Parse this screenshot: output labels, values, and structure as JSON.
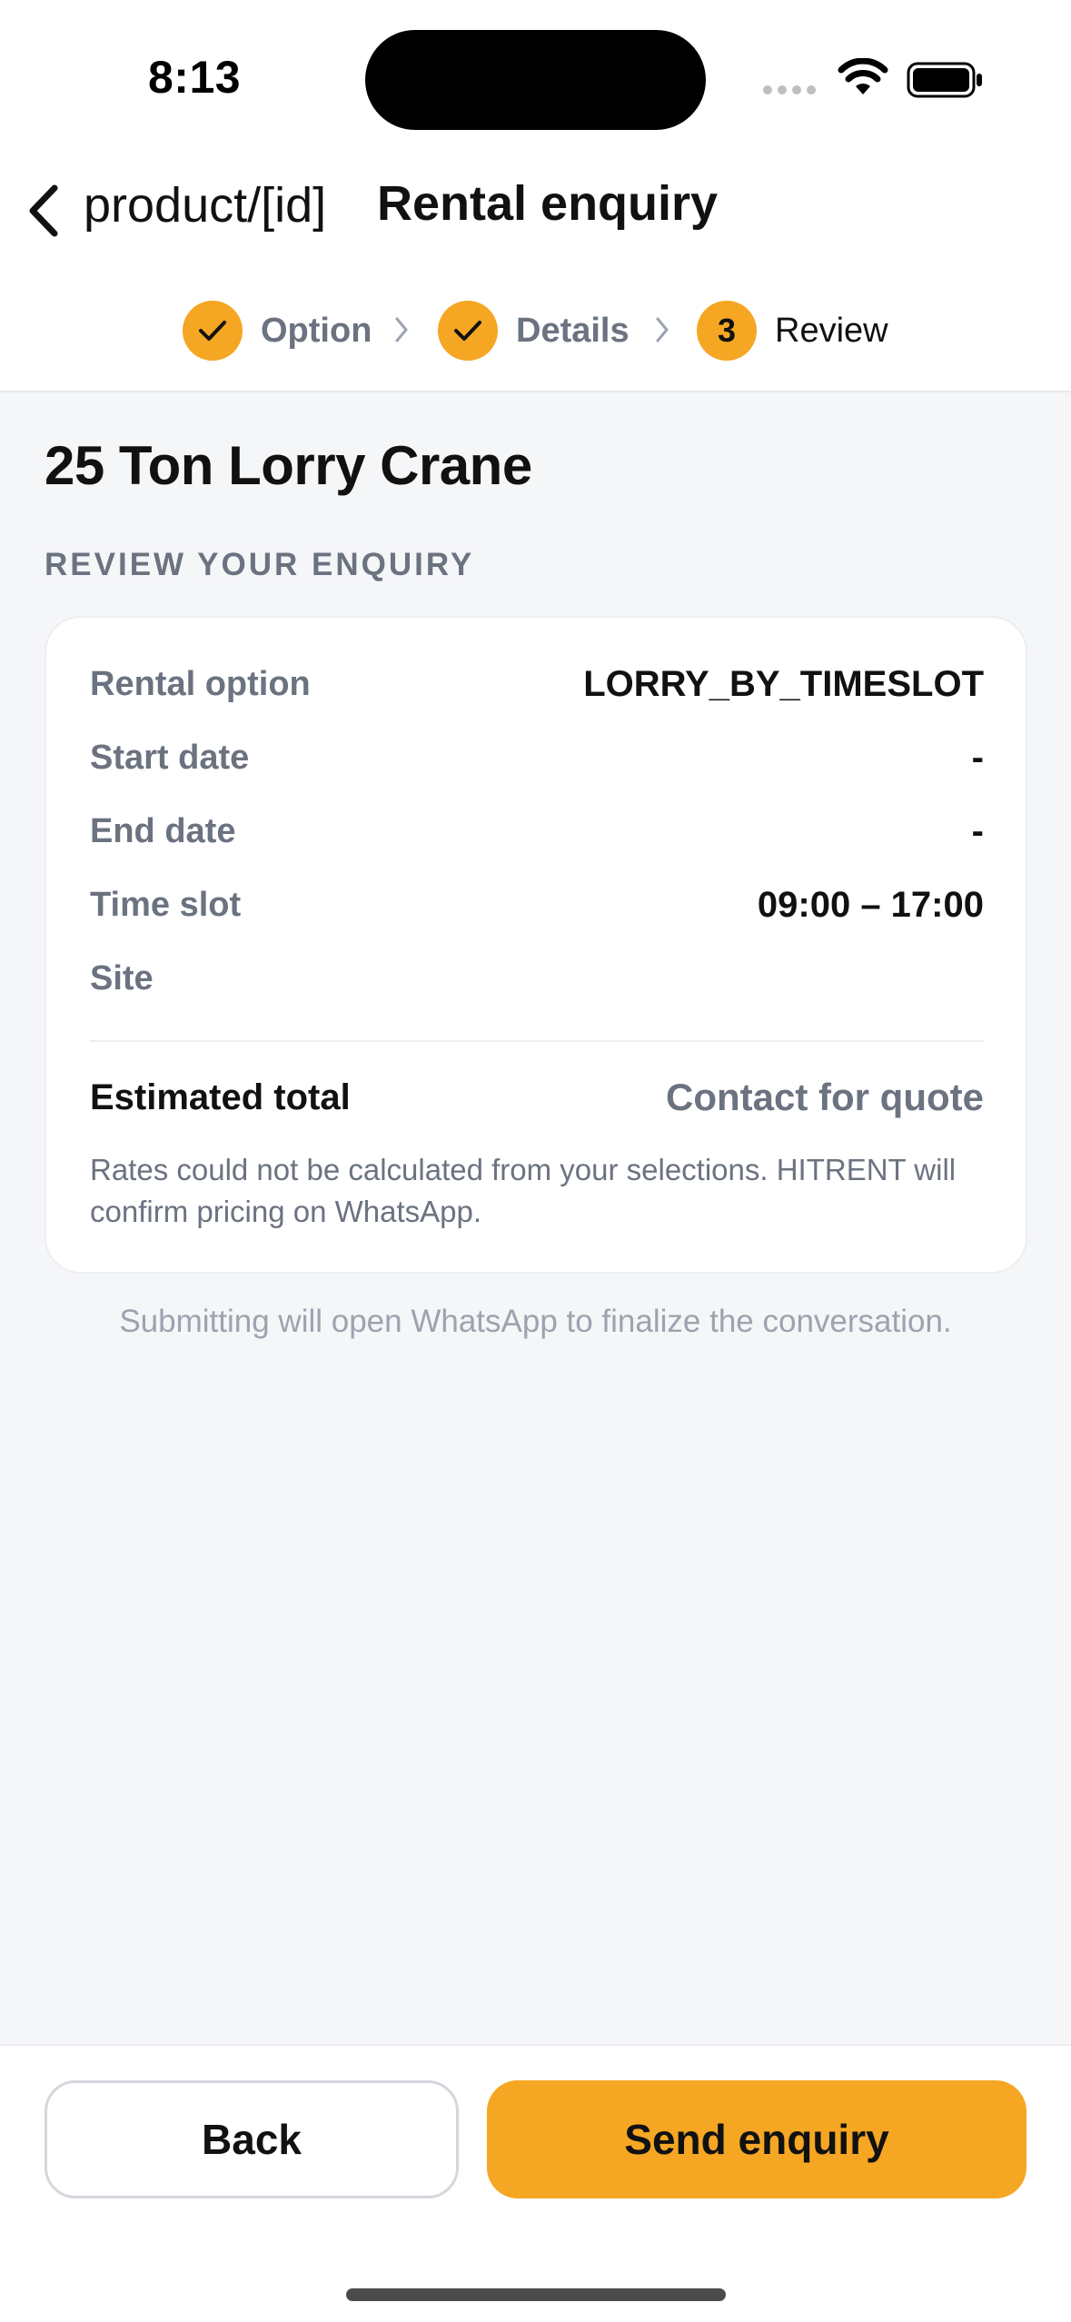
{
  "status_bar": {
    "time": "8:13"
  },
  "nav": {
    "back_label": "product/[id]",
    "title": "Rental enquiry"
  },
  "stepper": {
    "steps": [
      {
        "label": "Option",
        "state": "done"
      },
      {
        "label": "Details",
        "state": "done"
      },
      {
        "label": "Review",
        "number": "3",
        "state": "active"
      }
    ]
  },
  "product": {
    "title": "25 Ton Lorry Crane"
  },
  "review": {
    "section_label": "REVIEW YOUR ENQUIRY",
    "rows": [
      {
        "label": "Rental option",
        "value": "LORRY_BY_TIMESLOT"
      },
      {
        "label": "Start date",
        "value": "-"
      },
      {
        "label": "End date",
        "value": "-"
      },
      {
        "label": "Time slot",
        "value": "09:00 – 17:00"
      },
      {
        "label": "Site",
        "value": ""
      }
    ],
    "total_label": "Estimated total",
    "total_value": "Contact for quote",
    "note": "Rates could not be calculated from your selections. HITRENT will confirm pricing on WhatsApp."
  },
  "footnote": "Submitting will open WhatsApp to finalize the conversation.",
  "actions": {
    "back_label": "Back",
    "send_label": "Send enquiry"
  },
  "colors": {
    "accent": "#f5a623",
    "background": "#f5f6f8",
    "muted_text": "#6b7280"
  }
}
